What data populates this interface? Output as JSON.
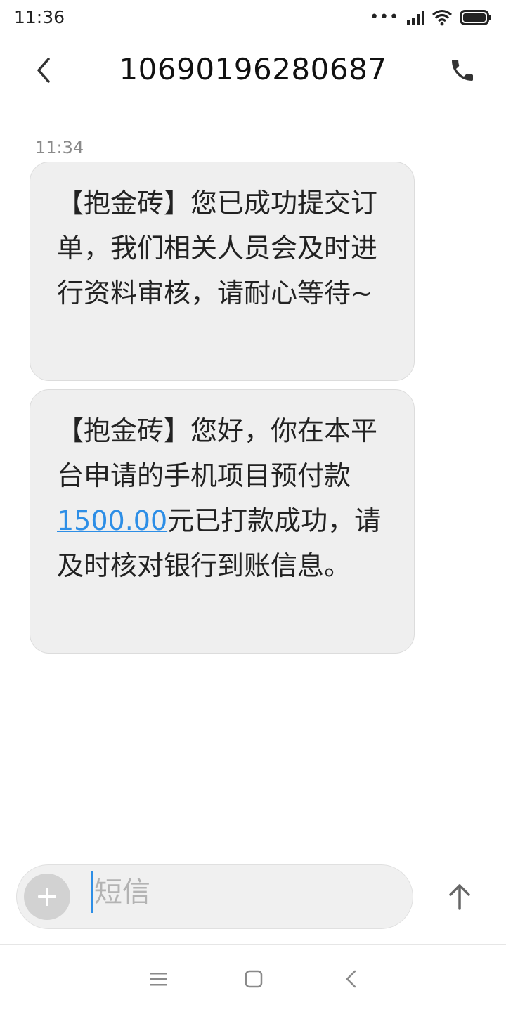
{
  "status_bar": {
    "time": "11:36",
    "icons": [
      "more-dots-icon",
      "signal-icon",
      "wifi-icon",
      "battery-icon"
    ]
  },
  "header": {
    "contact": "10690196280687",
    "back_icon": "chevron-left-icon",
    "call_icon": "phone-icon"
  },
  "thread": {
    "timestamp": "11:34",
    "messages": [
      {
        "text": "【抱金砖】您已成功提交订单，我们相关人员会及时进行资料审核，请耐心等待~"
      },
      {
        "text_before": "【抱金砖】您好，你在本平台申请的手机项目预付款",
        "amount": "1500.00",
        "text_after": "元已打款成功，请及时核对银行到账信息。"
      }
    ]
  },
  "composer": {
    "placeholder": "短信",
    "value": "",
    "add_icon": "plus-icon",
    "send_icon": "arrow-up-icon"
  },
  "nav_bar": {
    "icons": [
      "menu-icon",
      "home-square-icon",
      "back-triangle-icon"
    ]
  },
  "colors": {
    "accent": "#2d8ee6",
    "bubble_bg": "#efefef",
    "muted_text": "#8a8a8a"
  }
}
